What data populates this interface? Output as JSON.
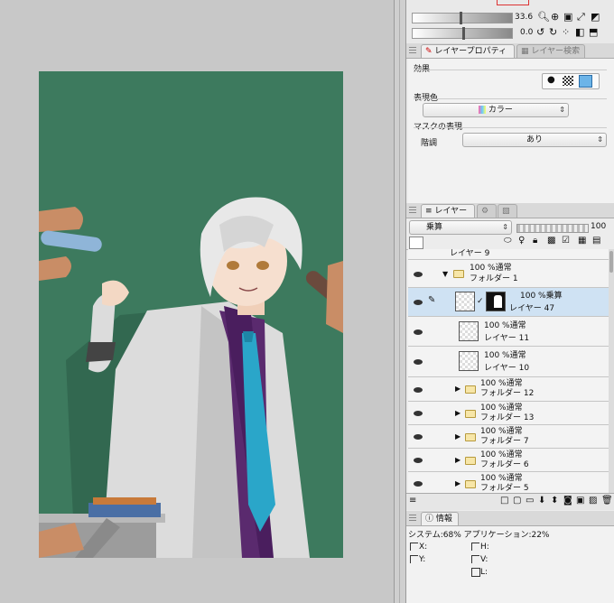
{
  "top_controls": {
    "zoom_value": "33.6",
    "angle_value": "0.0"
  },
  "layer_property": {
    "tab_label": "レイヤープロパティ",
    "tab2_label": "レイヤー検索",
    "effect_label": "効果",
    "expression_color_label": "表現色",
    "expression_color_value": "カラー",
    "mask_label": "マスクの表現",
    "gradation_label": "階調",
    "gradation_value": "あり"
  },
  "layer_panel": {
    "tab_label": "レイヤー",
    "blend_mode": "乗算",
    "opacity": "100",
    "partial_top_row": "レイヤー 9",
    "rows": [
      {
        "line1": "100 %通常",
        "line2": "フォルダー 1",
        "kind": "folder-open"
      },
      {
        "line1": "100 %乗算",
        "line2": "レイヤー 47",
        "kind": "layer-selected"
      },
      {
        "line1": "100 %通常",
        "line2": "レイヤー 11",
        "kind": "layer"
      },
      {
        "line1": "100 %通常",
        "line2": "レイヤー 10",
        "kind": "layer"
      },
      {
        "line1": "100 %通常",
        "line2": "フォルダー 12",
        "kind": "folder"
      },
      {
        "line1": "100 %通常",
        "line2": "フォルダー 13",
        "kind": "folder"
      },
      {
        "line1": "100 %通常",
        "line2": "フォルダー 7",
        "kind": "folder"
      },
      {
        "line1": "100 %通常",
        "line2": "フォルダー 6",
        "kind": "folder"
      },
      {
        "line1": "100 %通常",
        "line2": "フォルダー 5",
        "kind": "folder"
      }
    ]
  },
  "info_panel": {
    "tab_label": "情報",
    "system_text": "システム:68% アプリケーション:22%",
    "x_label": "X:",
    "y_label": "Y:",
    "h_label": "H:",
    "v_label": "V:",
    "l_label": "L:"
  },
  "colors": {
    "canvas_green": "#3d7a5e",
    "selected_row": "#cfe2f3",
    "tie": "#2aa6c9",
    "shirt": "#5a2a6e"
  }
}
